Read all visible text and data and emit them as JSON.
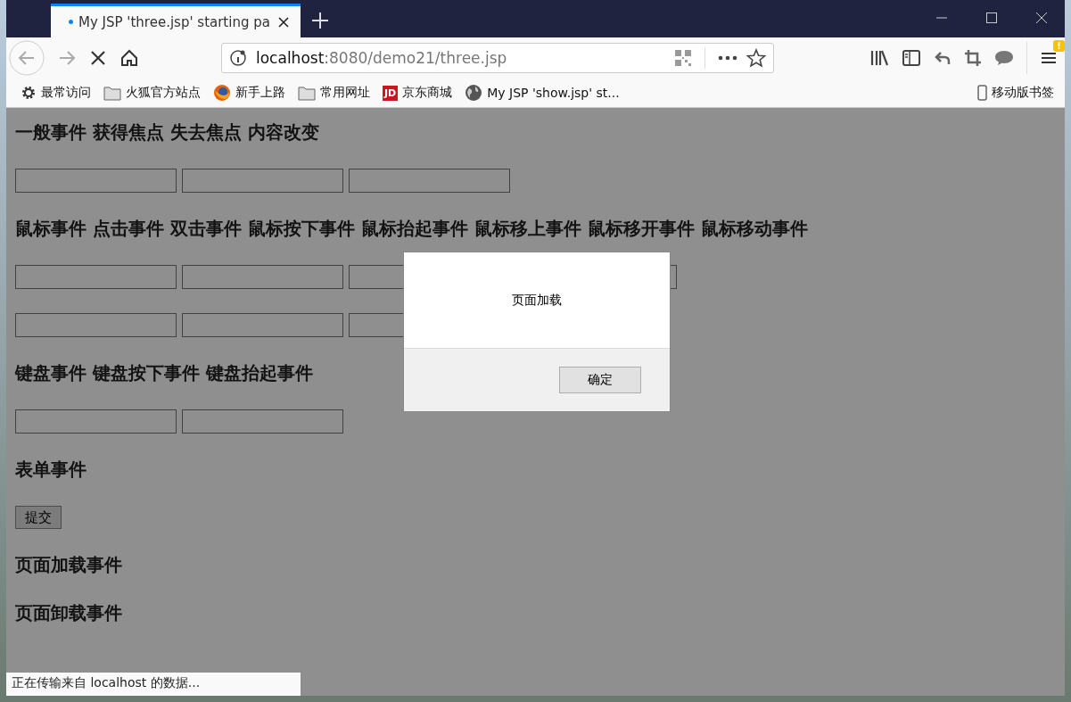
{
  "tab": {
    "title": "My JSP 'three.jsp' starting pa",
    "loading": true
  },
  "address": {
    "host": "localhost",
    "path": ":8080/demo21/three.jsp"
  },
  "toolbar": {
    "menu_badge": "!"
  },
  "bookmarks": [
    {
      "kind": "gear",
      "label": "最常访问"
    },
    {
      "kind": "folder",
      "label": "火狐官方站点"
    },
    {
      "kind": "firefox",
      "label": "新手上路"
    },
    {
      "kind": "folder",
      "label": "常用网址"
    },
    {
      "kind": "jd",
      "icon_text": "JD",
      "label": "京东商城"
    },
    {
      "kind": "globe",
      "label": "My JSP 'show.jsp' st..."
    }
  ],
  "mobile_bookmarks": "移动版书签",
  "sections": [
    {
      "heading": "一般事件 获得焦点 失去焦点 内容改变",
      "rows": [
        [
          {
            "kind": "text"
          },
          {
            "kind": "text"
          },
          {
            "kind": "text"
          }
        ]
      ]
    },
    {
      "heading": "鼠标事件 点击事件 双击事件 鼠标按下事件 鼠标抬起事件 鼠标移上事件 鼠标移开事件 鼠标移动事件",
      "rows": [
        [
          {
            "kind": "text"
          },
          {
            "kind": "text"
          },
          {
            "kind": "text"
          },
          {
            "kind": "text"
          }
        ],
        [
          {
            "kind": "text"
          },
          {
            "kind": "text"
          },
          {
            "kind": "text"
          }
        ]
      ]
    },
    {
      "heading": "键盘事件 键盘按下事件 键盘抬起事件",
      "rows": [
        [
          {
            "kind": "text"
          },
          {
            "kind": "text"
          }
        ]
      ]
    },
    {
      "heading": "表单事件",
      "rows": [
        [
          {
            "kind": "button",
            "label": "提交"
          }
        ]
      ]
    },
    {
      "heading": "页面加载事件"
    },
    {
      "heading": "页面卸载事件"
    }
  ],
  "dialog": {
    "message": "页面加载",
    "button": "确定"
  },
  "status_bar": "正在传输来自 localhost 的数据..."
}
